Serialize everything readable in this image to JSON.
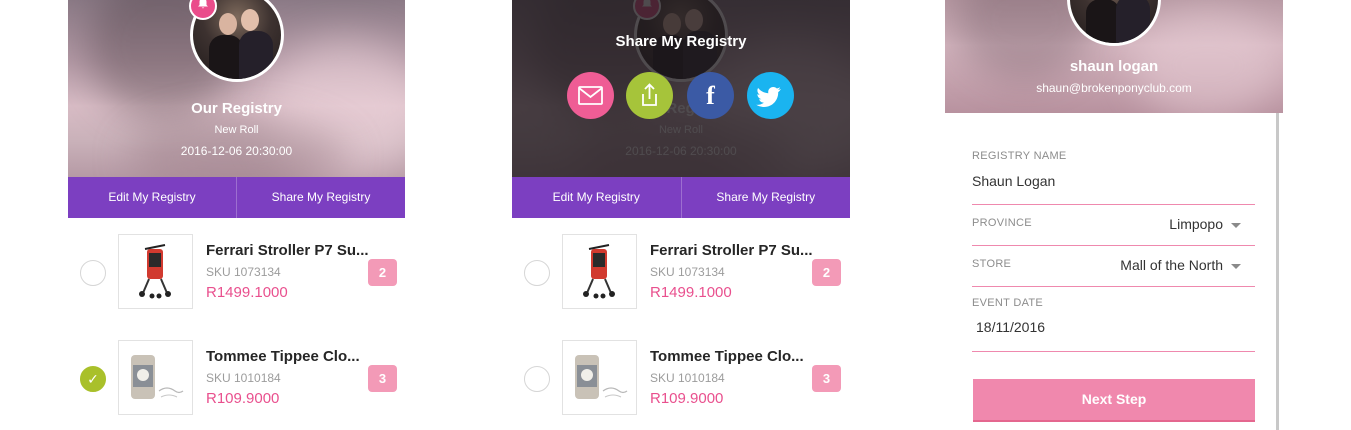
{
  "registry": {
    "title": "Our Registry",
    "subtitle": "New Roll",
    "date": "2016-12-06 20:30:00",
    "edit_label": "Edit My Registry",
    "share_label": "Share My Registry"
  },
  "items": [
    {
      "name": "Ferrari Stroller P7 Su...",
      "sku": "SKU 1073134",
      "price": "R1499.1000",
      "qty": "2",
      "checked_panel1": false
    },
    {
      "name": "Tommee Tippee Clo...",
      "sku": "SKU 1010184",
      "price": "R109.9000",
      "qty": "3",
      "checked_panel1": true
    }
  ],
  "share_overlay": {
    "title": "Share My Registry",
    "icons": [
      "envelope-icon",
      "share-icon",
      "facebook-icon",
      "twitter-icon"
    ],
    "facebook_glyph": "f"
  },
  "profile": {
    "name": "shaun logan",
    "email": "shaun@brokenponyclub.com"
  },
  "form": {
    "registry_name_label": "REGISTRY NAME",
    "registry_name_value": "Shaun Logan",
    "province_label": "PROVINCE",
    "province_value": "Limpopo",
    "store_label": "STORE",
    "store_value": "Mall of the North",
    "event_date_label": "EVENT DATE",
    "event_date_value": "18/11/2016",
    "next_label": "Next Step"
  },
  "colors": {
    "purple": "#7c3fc1",
    "pink": "#e9508e",
    "qty_badge": "#f39ab7",
    "check_green": "#a9c02a",
    "button_pink": "#f088ad"
  }
}
